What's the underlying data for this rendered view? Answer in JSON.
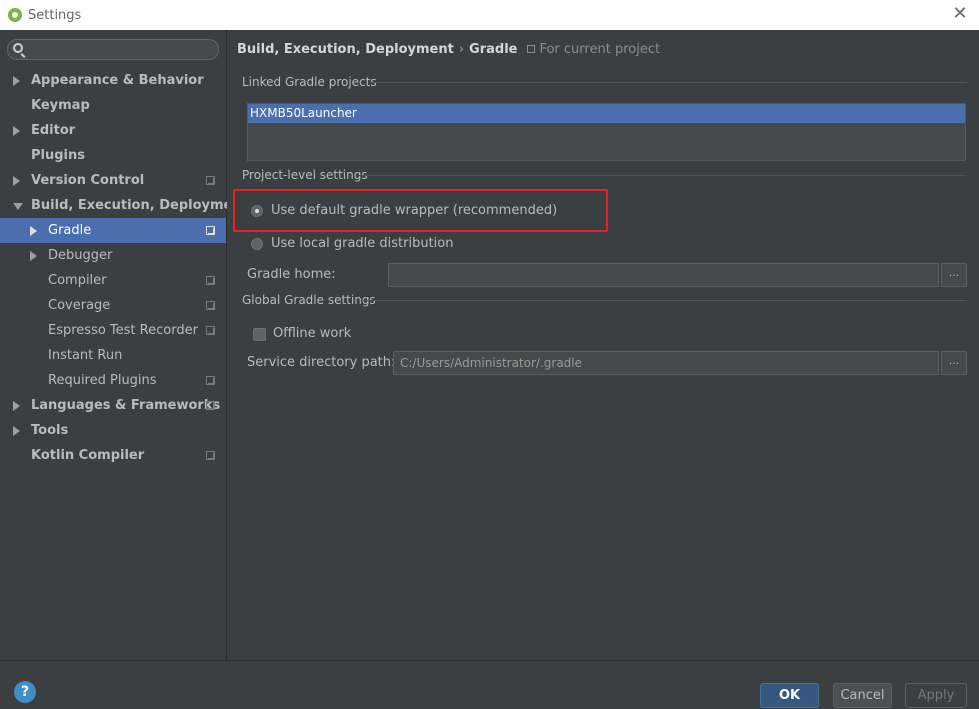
{
  "window": {
    "title": "Settings",
    "close_glyph": "✕"
  },
  "sidebar": {
    "search": {
      "value": "",
      "placeholder": ""
    },
    "items": [
      {
        "label": "Appearance & Behavior",
        "level": 0,
        "expandable": true,
        "expanded": false,
        "project_scope": false
      },
      {
        "label": "Keymap",
        "level": 0,
        "expandable": false,
        "project_scope": false
      },
      {
        "label": "Editor",
        "level": 0,
        "expandable": true,
        "expanded": false,
        "project_scope": false
      },
      {
        "label": "Plugins",
        "level": 0,
        "expandable": false,
        "project_scope": false
      },
      {
        "label": "Version Control",
        "level": 0,
        "expandable": true,
        "expanded": false,
        "project_scope": true
      },
      {
        "label": "Build, Execution, Deployment",
        "level": 0,
        "expandable": true,
        "expanded": true,
        "project_scope": false
      },
      {
        "label": "Gradle",
        "level": 1,
        "expandable": true,
        "expanded": false,
        "project_scope": true,
        "selected": true
      },
      {
        "label": "Debugger",
        "level": 1,
        "expandable": true,
        "expanded": false,
        "project_scope": false
      },
      {
        "label": "Compiler",
        "level": 1,
        "expandable": false,
        "project_scope": true
      },
      {
        "label": "Coverage",
        "level": 1,
        "expandable": false,
        "project_scope": true
      },
      {
        "label": "Espresso Test Recorder",
        "level": 1,
        "expandable": false,
        "project_scope": true
      },
      {
        "label": "Instant Run",
        "level": 1,
        "expandable": false,
        "project_scope": false
      },
      {
        "label": "Required Plugins",
        "level": 1,
        "expandable": false,
        "project_scope": true
      },
      {
        "label": "Languages & Frameworks",
        "level": 0,
        "expandable": true,
        "expanded": false,
        "project_scope": true
      },
      {
        "label": "Tools",
        "level": 0,
        "expandable": true,
        "expanded": false,
        "project_scope": false
      },
      {
        "label": "Kotlin Compiler",
        "level": 0,
        "expandable": false,
        "project_scope": true
      }
    ]
  },
  "main": {
    "breadcrumb": {
      "parent": "Build, Execution, Deployment",
      "separator": "›",
      "current": "Gradle",
      "scope": "For current project"
    },
    "linked_projects": {
      "title": "Linked Gradle projects",
      "items": [
        "HXMB50Launcher"
      ]
    },
    "project_level": {
      "title": "Project-level settings",
      "option_default": {
        "label": "Use default gradle wrapper (recommended)",
        "checked": true
      },
      "option_local": {
        "label": "Use local gradle distribution",
        "checked": false
      },
      "gradle_home": {
        "label": "Gradle home:",
        "value": "",
        "browse": "..."
      }
    },
    "global": {
      "title": "Global Gradle settings",
      "offline": {
        "label": "Offline work",
        "checked": false
      },
      "service_dir": {
        "label": "Service directory path:",
        "value": "C:/Users/Administrator/.gradle",
        "browse": "..."
      }
    }
  },
  "footer": {
    "help": "?",
    "ok": "OK",
    "cancel": "Cancel",
    "apply": "Apply"
  },
  "colors": {
    "background": "#3c3f41",
    "selection": "#4b6eaf",
    "highlight_box": "#e52525",
    "ok_button": "#365880"
  }
}
